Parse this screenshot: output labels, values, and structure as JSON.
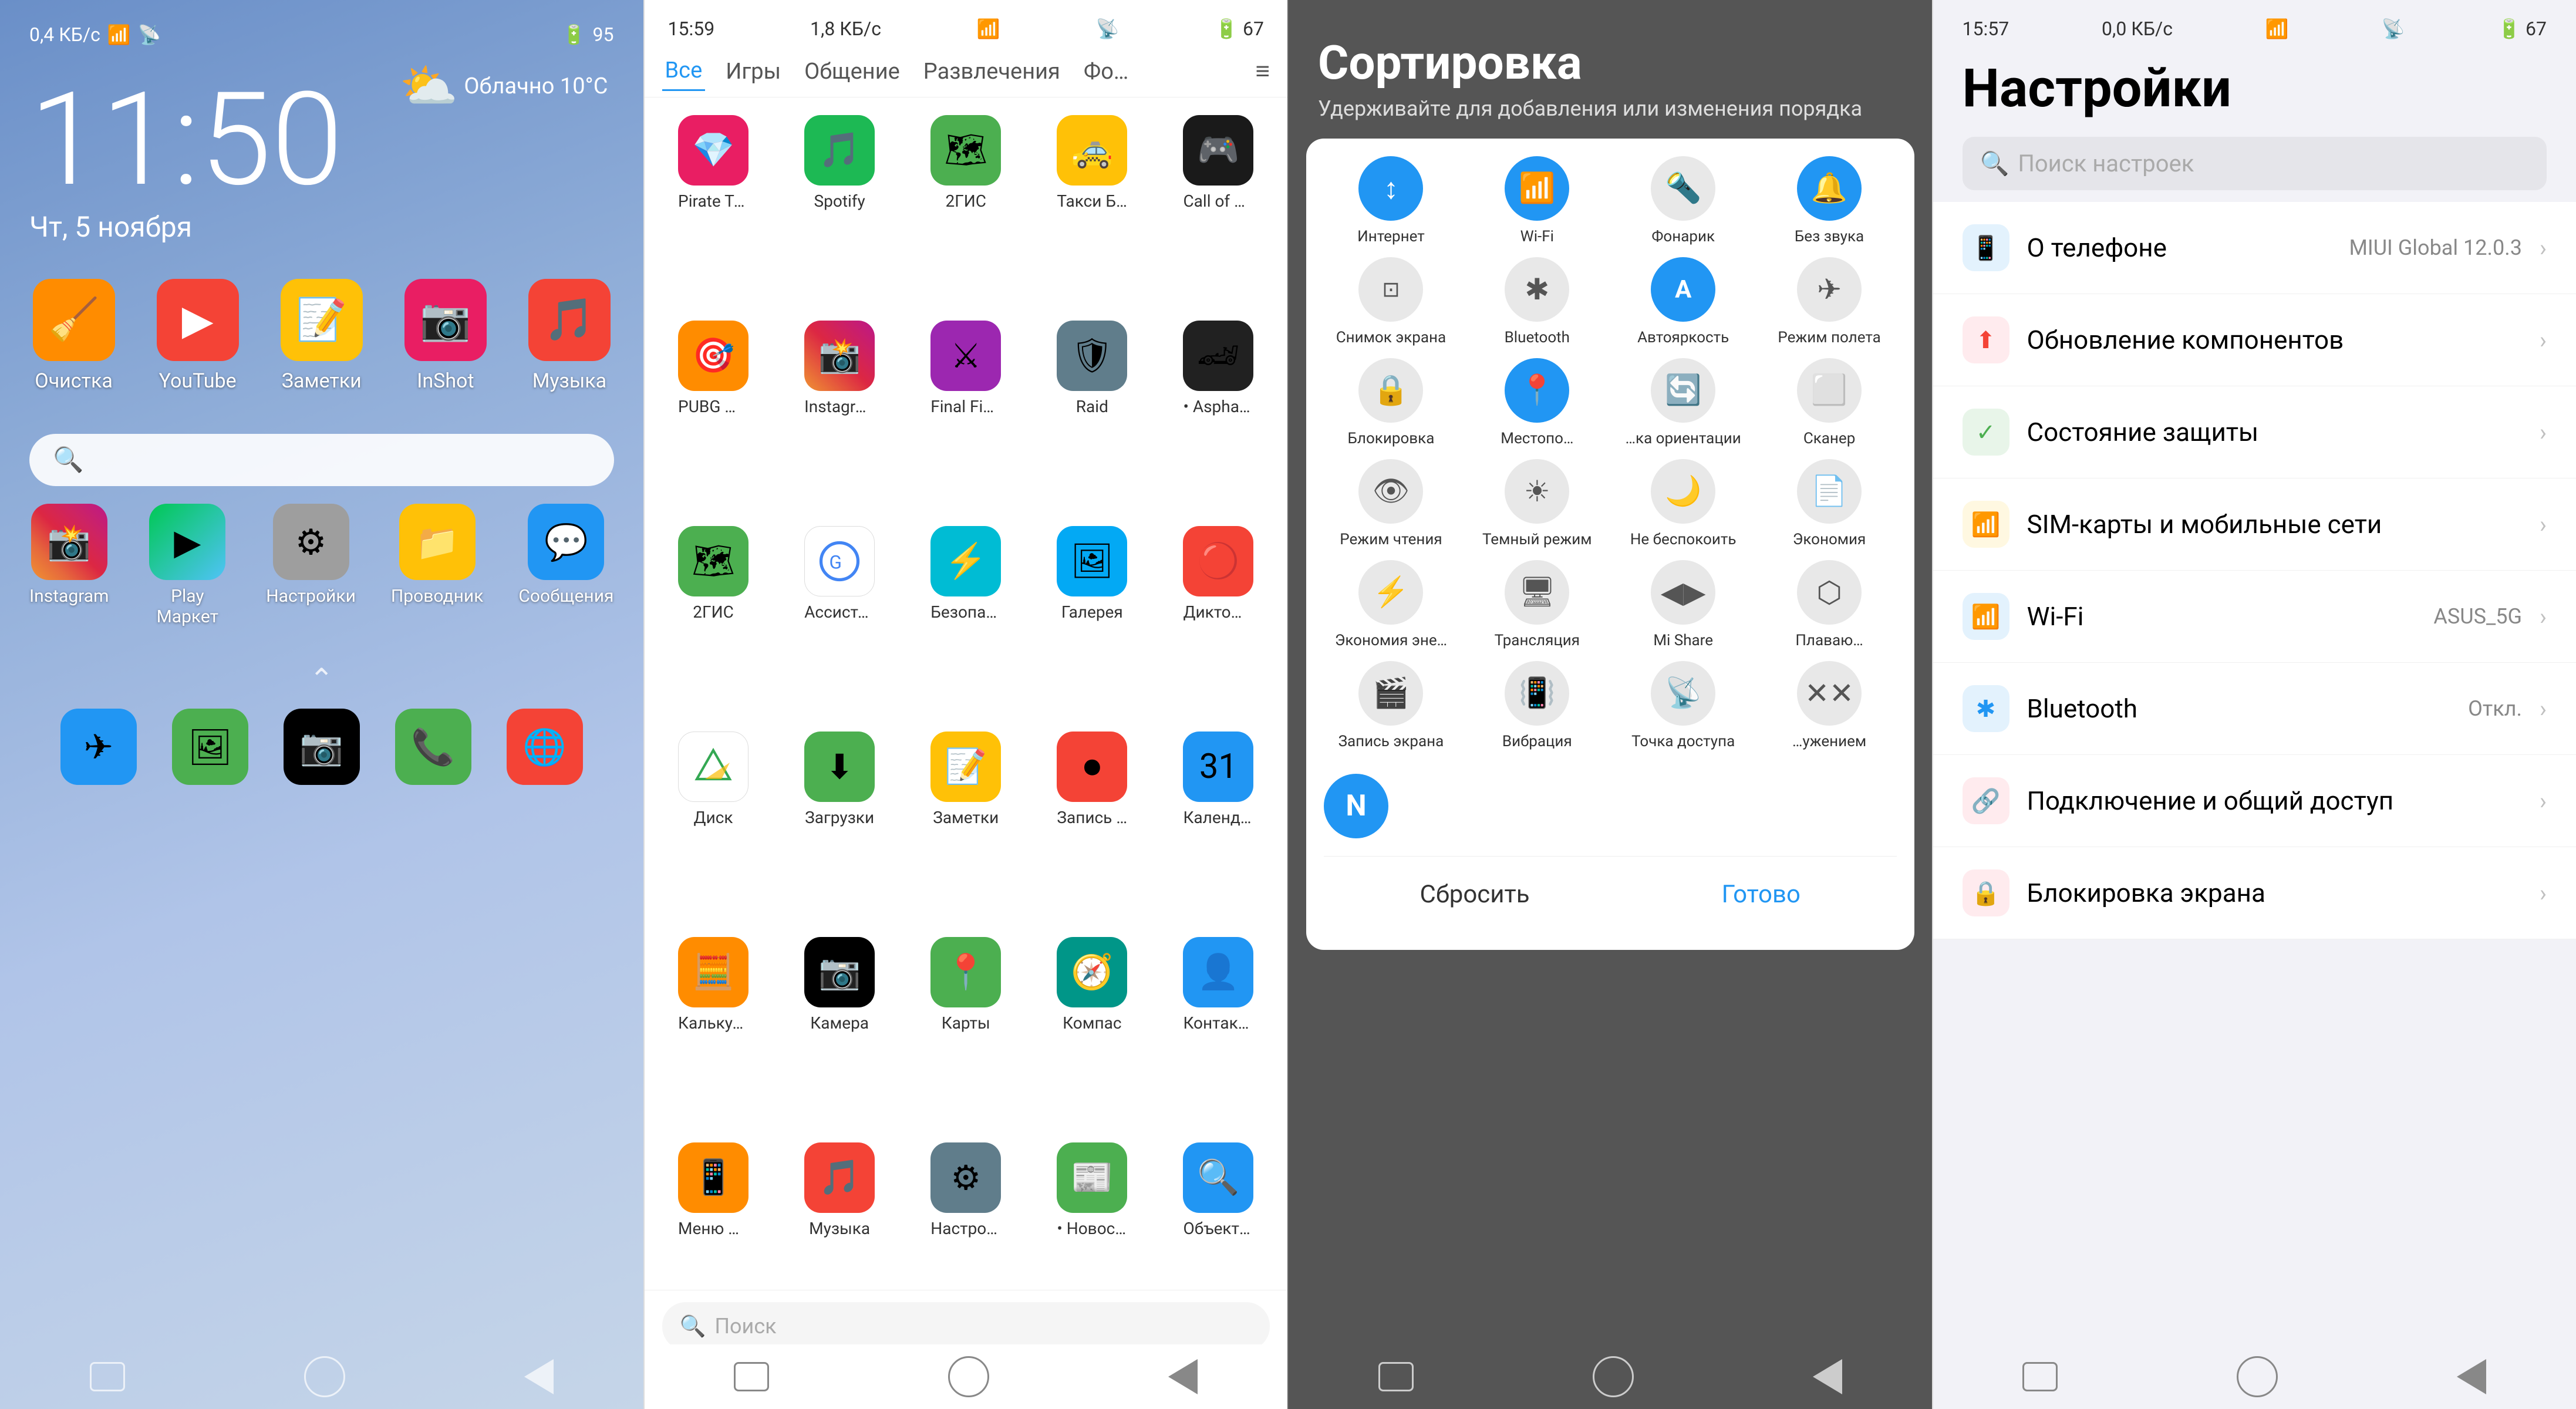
{
  "screen1": {
    "status_left": "0,4 КБ/с",
    "status_right": "Облачно  10°C",
    "clock": "11:50",
    "date": "Чт, 5 ноября",
    "weather": "☁️",
    "apps_row1": [
      {
        "label": "Очистка",
        "icon": "🧹",
        "color": "#FF8C00"
      },
      {
        "label": "YouTube",
        "icon": "▶",
        "color": "#f44336"
      },
      {
        "label": "Заметки",
        "icon": "📝",
        "color": "#FFC107"
      },
      {
        "label": "InShot",
        "icon": "📷",
        "color": "#e91e63"
      },
      {
        "label": "Музыка",
        "icon": "🎵",
        "color": "#f44336"
      }
    ],
    "dock": [
      {
        "label": "Instagram",
        "icon": "📸",
        "color": "linear-gradient(45deg,#f09433,#e6683c,#dc2743,#cc2366,#bc1888)"
      },
      {
        "label": "Play Маркет",
        "icon": "▶",
        "color": "linear-gradient(135deg,#00c853,#4fc3f7)"
      },
      {
        "label": "Настройки",
        "icon": "⚙",
        "color": "#607d8b"
      },
      {
        "label": "Проводник",
        "icon": "📁",
        "color": "#FFC107"
      },
      {
        "label": "Сообщения",
        "icon": "💬",
        "color": "#2196F3"
      }
    ],
    "dock2": [
      {
        "label": "",
        "icon": "✈",
        "color": "#2196F3"
      },
      {
        "label": "",
        "icon": "🖼",
        "color": "#4CAF50"
      },
      {
        "label": "",
        "icon": "📷",
        "color": "#000"
      },
      {
        "label": "",
        "icon": "📞",
        "color": "#4CAF50"
      },
      {
        "label": "",
        "icon": "🌐",
        "color": "#f44336"
      }
    ]
  },
  "screen2": {
    "status_time": "15:59",
    "status_data": "1,8 КБ/с",
    "tabs": [
      "Все",
      "Игры",
      "Общение",
      "Развлечения",
      "Фо…"
    ],
    "apps": [
      {
        "label": "Pirate Trea…",
        "icon": "💎",
        "color": "#e91e63"
      },
      {
        "label": "Spotify",
        "icon": "🎵",
        "color": "#1DB954"
      },
      {
        "label": "2ГИС",
        "icon": "🗺",
        "color": "#4CAF50"
      },
      {
        "label": "Такси Бонд",
        "icon": "🚕",
        "color": "#FFC107"
      },
      {
        "label": "Call of Duty",
        "icon": "🎮",
        "color": "#1a1a1a"
      },
      {
        "label": "PUBG MO…",
        "icon": "🎯",
        "color": "#FF8C00"
      },
      {
        "label": "Instagram",
        "icon": "📸",
        "color": "#e91e63"
      },
      {
        "label": "Final Fight…",
        "icon": "⚔",
        "color": "#9C27B0"
      },
      {
        "label": "Raid",
        "icon": "🛡",
        "color": "#607d8b"
      },
      {
        "label": "• Asphalt…",
        "icon": "🏎",
        "color": "#212121"
      },
      {
        "label": "2ГИС",
        "icon": "🗺",
        "color": "#4CAF50"
      },
      {
        "label": "Ассистент",
        "icon": "🔵",
        "color": "#2196F3"
      },
      {
        "label": "Безопасн…",
        "icon": "⚡",
        "color": "#00BCD4"
      },
      {
        "label": "Галерея",
        "icon": "🖼",
        "color": "#03A9F4"
      },
      {
        "label": "Диктофон",
        "icon": "🔴",
        "color": "#f44336"
      },
      {
        "label": "Диск",
        "icon": "▲",
        "color": "#FFC107"
      },
      {
        "label": "Загрузки",
        "icon": "⬇",
        "color": "#4CAF50"
      },
      {
        "label": "Заметки",
        "icon": "📝",
        "color": "#FFC107"
      },
      {
        "label": "Запись экр.",
        "icon": "⏺",
        "color": "#f44336"
      },
      {
        "label": "Календарь",
        "icon": "📅",
        "color": "#2196F3"
      },
      {
        "label": "Калькуля…",
        "icon": "🧮",
        "color": "#FF8C00"
      },
      {
        "label": "Камера",
        "icon": "📷",
        "color": "#000"
      },
      {
        "label": "Карты",
        "icon": "📍",
        "color": "#4CAF50"
      },
      {
        "label": "Компас",
        "icon": "🧭",
        "color": "#009688"
      },
      {
        "label": "Контакты",
        "icon": "👤",
        "color": "#2196F3"
      },
      {
        "label": "Меню SIM…",
        "icon": "📱",
        "color": "#FF8C00"
      },
      {
        "label": "Музыка",
        "icon": "🎵",
        "color": "#f44336"
      },
      {
        "label": "Настройки",
        "icon": "⚙",
        "color": "#607d8b"
      },
      {
        "label": "• Новости",
        "icon": "📰",
        "color": "#4CAF50"
      },
      {
        "label": "Объектив",
        "icon": "🔍",
        "color": "#2196F3"
      }
    ],
    "search_placeholder": "Поиск"
  },
  "screen3": {
    "title": "Сортировка",
    "subtitle": "Удерживайте для добавления или изменения порядка",
    "items": [
      {
        "label": "Интернет",
        "icon": "↕",
        "active": true
      },
      {
        "label": "Wi-Fi",
        "icon": "📶",
        "active": true
      },
      {
        "label": "Фонарик",
        "icon": "🔦",
        "active": false
      },
      {
        "label": "Без звука",
        "icon": "🔔",
        "active": true
      },
      {
        "label": "Снимок экрана",
        "icon": "📷",
        "active": false
      },
      {
        "label": "Bluetooth",
        "icon": "🔵",
        "active": false
      },
      {
        "label": "Автояркость",
        "icon": "A",
        "active": true
      },
      {
        "label": "Режим полета",
        "icon": "✈",
        "active": false
      },
      {
        "label": "Блокировка",
        "icon": "🔒",
        "active": false
      },
      {
        "label": "Местопо…",
        "icon": "📍",
        "active": true
      },
      {
        "label": "…ка ориентации",
        "icon": "🔄",
        "active": false
      },
      {
        "label": "Сканер",
        "icon": "⬜",
        "active": false
      },
      {
        "label": "Режим чтения",
        "icon": "👁",
        "active": false
      },
      {
        "label": "Темный режим",
        "icon": "☀",
        "active": false
      },
      {
        "label": "Не беспокоить",
        "icon": "🌙",
        "active": false
      },
      {
        "label": "Экономия",
        "icon": "📄",
        "active": false
      },
      {
        "label": "Экономия эне…",
        "icon": "⚡",
        "active": false
      },
      {
        "label": "Трансляция",
        "icon": "🖥",
        "active": false
      },
      {
        "label": "Mi Share",
        "icon": "◀▶",
        "active": false
      },
      {
        "label": "Плаваю…",
        "icon": "⬡",
        "active": false
      },
      {
        "label": "Запись экрана",
        "icon": "🎬",
        "active": false
      },
      {
        "label": "Вибрация",
        "icon": "📳",
        "active": false
      },
      {
        "label": "Точка доступа",
        "icon": "📡",
        "active": false
      },
      {
        "label": "…ужением",
        "icon": "✕✕",
        "active": false
      }
    ],
    "btn_reset": "Сбросить",
    "btn_done": "Готово",
    "add_icon": "N"
  },
  "screen4": {
    "status_time": "15:57",
    "status_data": "0,0 КБ/с",
    "title": "Настройки",
    "search_placeholder": "Поиск настроек",
    "items": [
      {
        "label": "О телефоне",
        "value": "MIUI Global 12.0.3",
        "icon": "📱",
        "icon_color": "#2196F3"
      },
      {
        "label": "Обновление компонентов",
        "value": "",
        "icon": "⬆",
        "icon_color": "#f44336"
      },
      {
        "label": "Состояние защиты",
        "value": "",
        "icon": "✓",
        "icon_color": "#4CAF50"
      },
      {
        "label": "SIM-карты и мобильные сети",
        "value": "",
        "icon": "📶",
        "icon_color": "#FFC107"
      },
      {
        "label": "Wi-Fi",
        "value": "ASUS_5G",
        "icon": "📶",
        "icon_color": "#2196F3"
      },
      {
        "label": "Bluetooth",
        "value": "Откл.",
        "icon": "🔵",
        "icon_color": "#2196F3"
      },
      {
        "label": "Подключение и общий доступ",
        "value": "",
        "icon": "🔗",
        "icon_color": "#f44336"
      },
      {
        "label": "Блокировка экрана",
        "value": "",
        "icon": "🔒",
        "icon_color": "#f44336"
      }
    ]
  }
}
